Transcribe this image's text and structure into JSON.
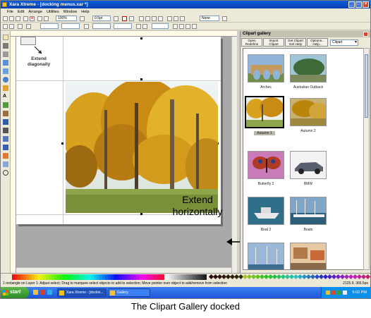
{
  "window": {
    "title": "Xara Xtreme - [docking menus.xar *]"
  },
  "menu": [
    "File",
    "Edit",
    "Arrange",
    "Utilities",
    "Window",
    "Help"
  ],
  "toolbar": {
    "zoom": "100%",
    "line_width": "0.5pt",
    "line_style": "None"
  },
  "canvas": {
    "extend_diagonally": "Extend\ndiagonally",
    "extend_horizontally": "Extend\nhorizontally"
  },
  "gallery": {
    "title": "Clipart gallery",
    "buttons": [
      "Open Redefine",
      "Import Clipart",
      "Get Clipart Get Help",
      "Options... Help..."
    ],
    "category": "Clipart",
    "items": [
      {
        "label": "Arches"
      },
      {
        "label": "Australian Outback"
      },
      {
        "label": "Autumn 1",
        "selected": true
      },
      {
        "label": "Autumn 2"
      },
      {
        "label": "Butterfly 2"
      },
      {
        "label": "BMW"
      },
      {
        "label": "Boat 2"
      },
      {
        "label": "Boats"
      },
      {
        "label": ""
      },
      {
        "label": ""
      }
    ]
  },
  "status": {
    "text": "1 rectangle on Layer 1: Adjust select; Drag to marquee select objects to add to selection; Move pointer over object to add/remove from selection",
    "coords": "2125.9, 366.5px"
  },
  "taskbar": {
    "start": "start",
    "tasks": [
      "Xara Xtreme - [dockin...",
      "Gallery"
    ],
    "clock": "5:02 PM"
  },
  "caption": "The Clipart Gallery docked",
  "colors": {
    "title_blue": "#0b4fd0",
    "taskbar_blue": "#2a64e0",
    "start_green": "#3a9b34"
  }
}
